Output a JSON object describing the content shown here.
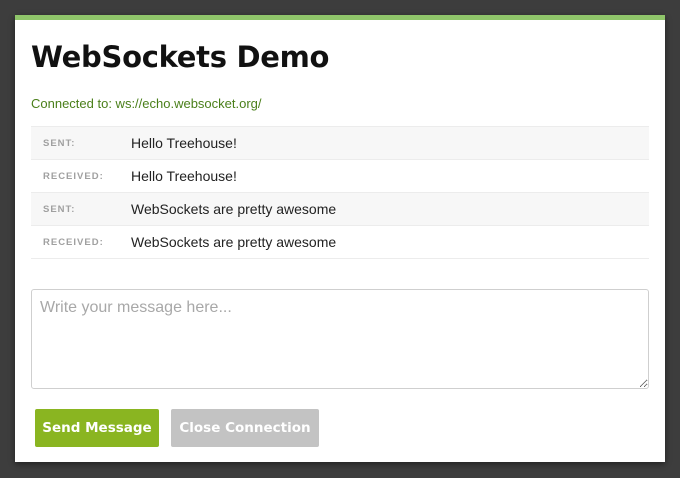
{
  "app": {
    "title": "WebSockets Demo",
    "status": "Connected to: ws://echo.websocket.org/"
  },
  "messages": [
    {
      "label": "SENT:",
      "text": "Hello Treehouse!"
    },
    {
      "label": "RECEIVED:",
      "text": "Hello Treehouse!"
    },
    {
      "label": "SENT:",
      "text": "WebSockets are pretty awesome"
    },
    {
      "label": "RECEIVED:",
      "text": "WebSockets are pretty awesome"
    }
  ],
  "form": {
    "message_value": "",
    "message_placeholder": "Write your message here...",
    "send_label": "Send Message",
    "close_label": "Close Connection"
  },
  "colors": {
    "accent_bar": "#8fc56a",
    "status_text": "#4a7f1a",
    "send_button": "#8ab521",
    "close_button": "#c3c3c3"
  }
}
